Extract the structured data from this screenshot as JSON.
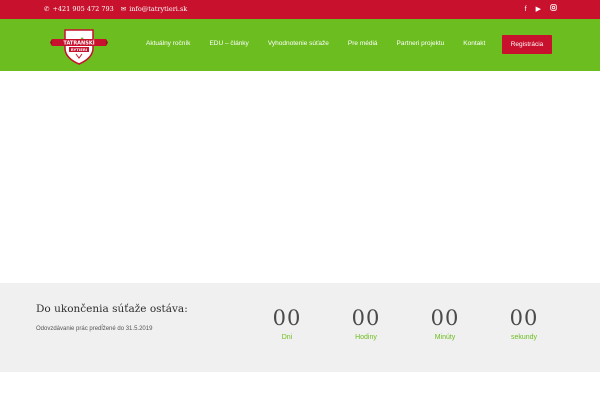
{
  "topbar": {
    "phone": "+421 905 472 793",
    "email": "info@tatrytieri.sk",
    "phone_icon": "phone-icon",
    "email_icon": "mail-icon",
    "social": [
      "facebook-icon",
      "youtube-icon",
      "instagram-icon"
    ]
  },
  "logo": {
    "line1": "TATRANSKÍ",
    "line2": "RYTIERI"
  },
  "nav": {
    "items": [
      "Aktuálny ročník",
      "EDU – články",
      "Vyhodnotenie súťaže",
      "Pre médiá",
      "Partneri projektu",
      "Kontakt"
    ],
    "cta": "Registrácia"
  },
  "countdown": {
    "title": "Do ukončenia súťaže ostáva:",
    "subtitle": "Odovzdávanie prác predĺžené do 31.5.2019",
    "units": [
      {
        "value": "00",
        "label": "Dni"
      },
      {
        "value": "00",
        "label": "Hodiny"
      },
      {
        "value": "00",
        "label": "Minúty"
      },
      {
        "value": "00",
        "label": "sekundy"
      }
    ]
  },
  "colors": {
    "red": "#c7112d",
    "green": "#6cbd1f",
    "panel": "#f0f0f0"
  }
}
